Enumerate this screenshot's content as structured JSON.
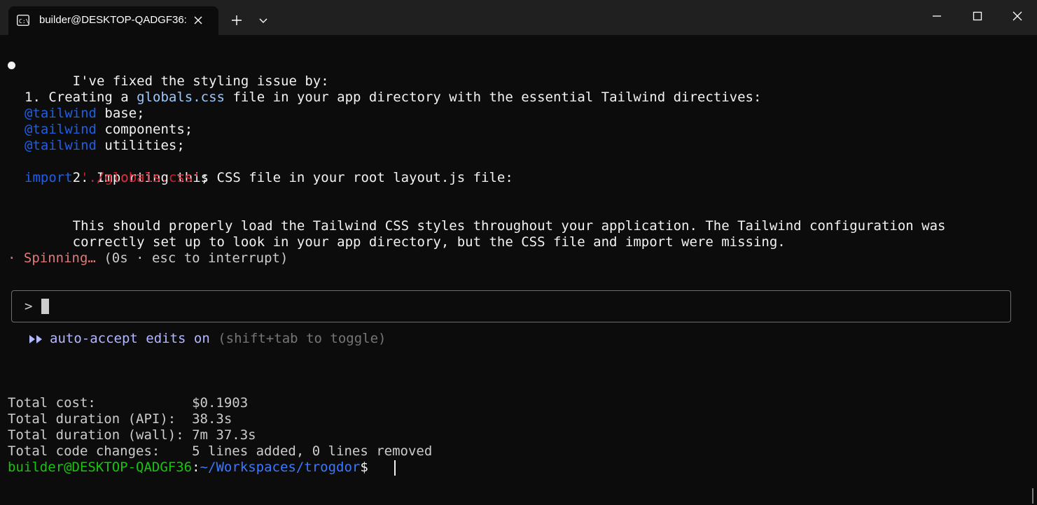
{
  "window": {
    "tab_title": "builder@DESKTOP-QADGF36:",
    "icons": {
      "tab": "terminal-icon",
      "close_tab": "close-icon",
      "new_tab": "plus-icon",
      "dropdown": "chevron-down-icon",
      "minimize": "minimize-icon",
      "maximize": "maximize-icon",
      "close_window": "close-icon"
    }
  },
  "colors": {
    "background": "#0c0c0c",
    "titlebar": "#202020",
    "text": "#cccccc",
    "highlight": "#9cc8ff",
    "keyword": "#1f5fe8",
    "string": "#d02030",
    "spinner": "#e07a7a",
    "mode": "#b4b8ff",
    "user": "#16c60c",
    "path": "#3b78ff"
  },
  "response": {
    "intro": "I've fixed the styling issue by:",
    "step1_prefix": "1. Creating a ",
    "step1_file": "globals.css",
    "step1_suffix": " file in your app directory with the essential Tailwind directives:",
    "directive_keyword": "@tailwind",
    "directives": [
      " base;",
      " components;",
      " utilities;"
    ],
    "step2": "2. Importing this CSS file in your root layout.js file:",
    "import_keyword": "import",
    "import_path": "'./globals.css'",
    "import_end": ";",
    "summary_line1": "This should properly load the Tailwind CSS styles throughout your application. The Tailwind configuration was",
    "summary_line2": "correctly set up to look in your app directory, but the CSS file and import were missing."
  },
  "status": {
    "spinner_glyph": "·",
    "spinner_text": "Spinning…",
    "spinner_detail": "(0s · esc to interrupt)"
  },
  "input": {
    "prompt": ">"
  },
  "mode": {
    "icon": "fast-forward-icon",
    "label": "auto-accept edits on",
    "hint": "(shift+tab to toggle)"
  },
  "stats": [
    {
      "label": "Total cost:            ",
      "value": "$0.1903"
    },
    {
      "label": "Total duration (API):  ",
      "value": "38.3s"
    },
    {
      "label": "Total duration (wall): ",
      "value": "7m 37.3s"
    },
    {
      "label": "Total code changes:    ",
      "value": "5 lines added, 0 lines removed"
    }
  ],
  "shell": {
    "user_host": "builder@DESKTOP-QADGF36",
    "colon": ":",
    "path": "~/Workspaces/trogdor",
    "symbol": "$"
  }
}
